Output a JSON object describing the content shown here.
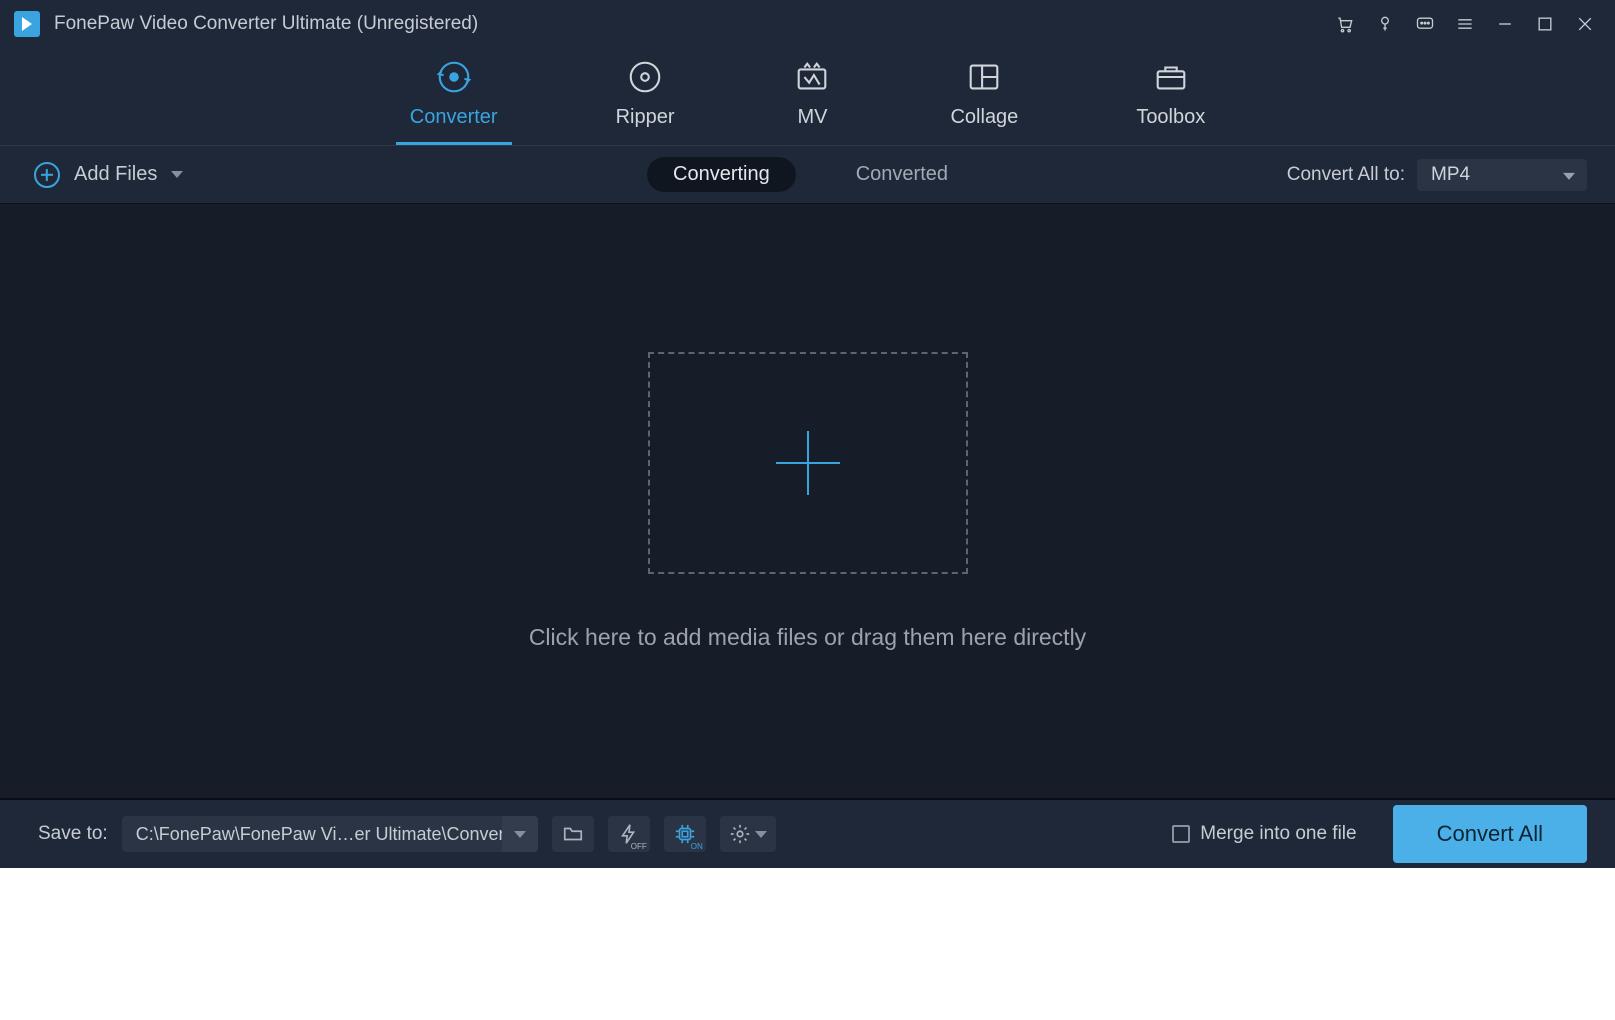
{
  "title": "FonePaw Video Converter Ultimate (Unregistered)",
  "nav": {
    "tabs": [
      {
        "label": "Converter"
      },
      {
        "label": "Ripper"
      },
      {
        "label": "MV"
      },
      {
        "label": "Collage"
      },
      {
        "label": "Toolbox"
      }
    ],
    "activeIndex": 0
  },
  "toolbar": {
    "add_files_label": "Add Files",
    "segment": {
      "converting": "Converting",
      "converted": "Converted",
      "activeIndex": 0
    },
    "convert_all_to_label": "Convert All to:",
    "selected_format": "MP4"
  },
  "drop": {
    "hint": "Click here to add media files or drag them here directly"
  },
  "bottom": {
    "save_to_label": "Save to:",
    "save_path": "C:\\FonePaw\\FonePaw Vi…er Ultimate\\Converted",
    "merge_label": "Merge into one file",
    "convert_all_label": "Convert All",
    "hw_accel_off_label": "OFF",
    "gpu_accel_on_label": "ON"
  }
}
